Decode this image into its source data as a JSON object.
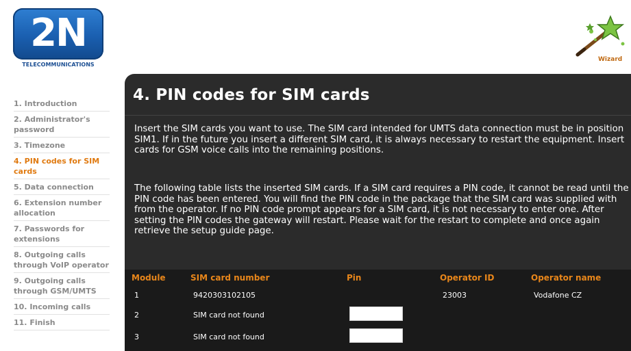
{
  "logo": {
    "brand": "2N",
    "subtitle": "TELECOMMUNICATIONS"
  },
  "wizard": {
    "label": "Wizard"
  },
  "sidebar": {
    "items": [
      {
        "label": "1. Introduction"
      },
      {
        "label": "2. Administrator's password"
      },
      {
        "label": "3. Timezone"
      },
      {
        "label": "4. PIN codes for SIM cards"
      },
      {
        "label": "5. Data connection"
      },
      {
        "label": "6. Extension number allocation"
      },
      {
        "label": "7. Passwords for extensions"
      },
      {
        "label": "8. Outgoing calls through VoIP operator"
      },
      {
        "label": "9. Outgoing calls through GSM/UMTS"
      },
      {
        "label": "10. Incoming calls"
      },
      {
        "label": "11. Finish"
      }
    ],
    "active_index": 3
  },
  "main": {
    "title": "4. PIN codes for SIM cards",
    "paragraph1": "Insert the SIM cards you want to use. The SIM card intended for UMTS data connection must be in position SIM1. If in the future you insert a different SIM card, it is always necessary to restart the equipment. Insert cards for GSM voice calls into the remaining positions.",
    "paragraph2": "The following table lists the inserted SIM cards. If a SIM card requires a PIN code, it cannot be read until the PIN code has been entered. You will find the PIN code in the package that the SIM card was supplied with from the operator. If no PIN code prompt appears for a SIM card, it is not necessary to enter one. After setting the PIN codes the gateway will restart. Please wait for the restart to complete and once again retrieve the setup guide page."
  },
  "table": {
    "headers": [
      "Module",
      "SIM card number",
      "Pin",
      "Operator ID",
      "Operator name"
    ],
    "rows": [
      {
        "module": "1",
        "sim": "9420303102105",
        "pin": "",
        "operator_id": "23003",
        "operator_name": "Vodafone CZ"
      },
      {
        "module": "2",
        "sim": "SIM card not found",
        "pin": "",
        "operator_id": "",
        "operator_name": ""
      },
      {
        "module": "3",
        "sim": "SIM card not found",
        "pin": "",
        "operator_id": "",
        "operator_name": ""
      }
    ]
  },
  "colors": {
    "accent": "#e8861a",
    "panel": "#2b2b2b",
    "brand_blue": "#1a5fb0"
  },
  "icons": {
    "wizard": "magic-wand-icon"
  }
}
